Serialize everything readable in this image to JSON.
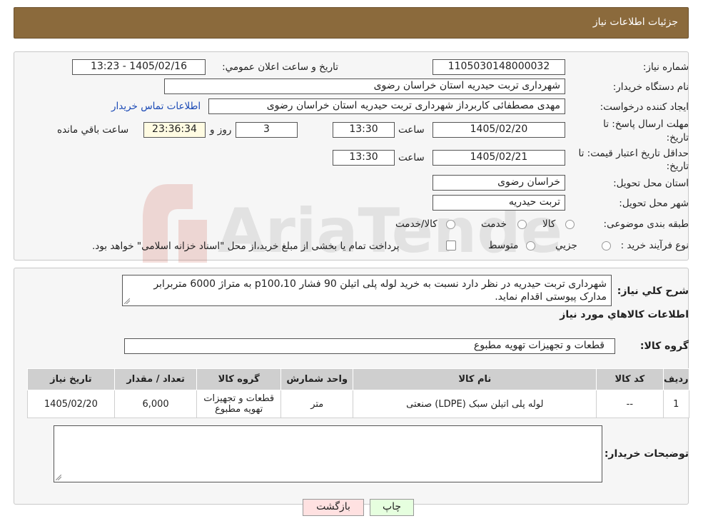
{
  "header": {
    "title": "جزئیات اطلاعات نیاز"
  },
  "form": {
    "need_number_label": "شماره نیاز:",
    "need_number": "1105030148000032",
    "announce_label": "تاریخ و ساعت اعلان عمومي:",
    "announce_value": "1405/02/16 - 13:23",
    "buyer_org_label": "نام دستگاه خريدار:",
    "buyer_org": "شهرداری تربت حیدریه استان خراسان رضوی",
    "creator_label": "ايجاد کننده درخواست:",
    "creator": "مهدی مصطفائی کاربرداز شهرداری تربت حیدریه استان خراسان رضوی",
    "contact_link": "اطلاعات تماس خريدار",
    "deadline_label_1": "مهلت ارسال پاسخ: تا",
    "deadline_label_2": "تاريخ:",
    "deadline_date": "1405/02/20",
    "time_label": "ساعت",
    "deadline_time": "13:30",
    "days_value": "3",
    "days_label": "روز و",
    "remaining_time": "23:36:34",
    "remaining_label": "ساعت باقي مانده",
    "validity_label_1": "حداقل تاريخ اعتبار قيمت: تا",
    "validity_label_2": "تاريخ:",
    "validity_date": "1405/02/21",
    "validity_time": "13:30",
    "province_label": "استان محل تحويل:",
    "province": "خراسان رضوی",
    "city_label": "شهر محل تحويل:",
    "city": "تربت حیدریه",
    "category_label": "طبقه بندی موضوعی:",
    "category_options": [
      "کالا",
      "خدمت",
      "کالا/خدمت"
    ],
    "process_label": "نوع فرآيند خريد :",
    "process_options": [
      "جزيي",
      "متوسط"
    ],
    "process_note": "پرداخت تمام يا بخشی از مبلغ خريد،از محل \"اسناد خزانه اسلامی\" خواهد بود."
  },
  "description": {
    "label": "شرح کلي نياز:",
    "text": "شهرداری تربت حیدریه در نظر دارد نسبت به خرید لوله پلی اتیلن 90 فشار p100،10 به متراژ 6000 متربرابر مدارک پیوستی اقدام نماید."
  },
  "goods": {
    "section_title": "اطلاعات کالاهاي مورد نياز",
    "group_label": "گروه کالا:",
    "group_value": "قطعات و تجهیزات تهویه مطبوع",
    "columns": [
      "رديف",
      "کد کالا",
      "نام کالا",
      "واحد شمارش",
      "گروه کالا",
      "تعداد / مقدار",
      "تاريخ نياز"
    ],
    "rows": [
      [
        "1",
        "--",
        "لوله پلی اتیلن سبک (LDPE) صنعتی",
        "متر",
        "قطعات و تجهیزات تهویه مطبوع",
        "6,000",
        "1405/02/20"
      ]
    ]
  },
  "buyer_notes": {
    "label": "توضيحات خريدار:",
    "value": ""
  },
  "buttons": {
    "print": "چاپ",
    "back": "بازگشت"
  },
  "colors": {
    "header_bg": "#8b6a3c",
    "link": "#1a49b5",
    "back_btn": "#ffe1e1",
    "print_btn": "#e6ffdf"
  }
}
